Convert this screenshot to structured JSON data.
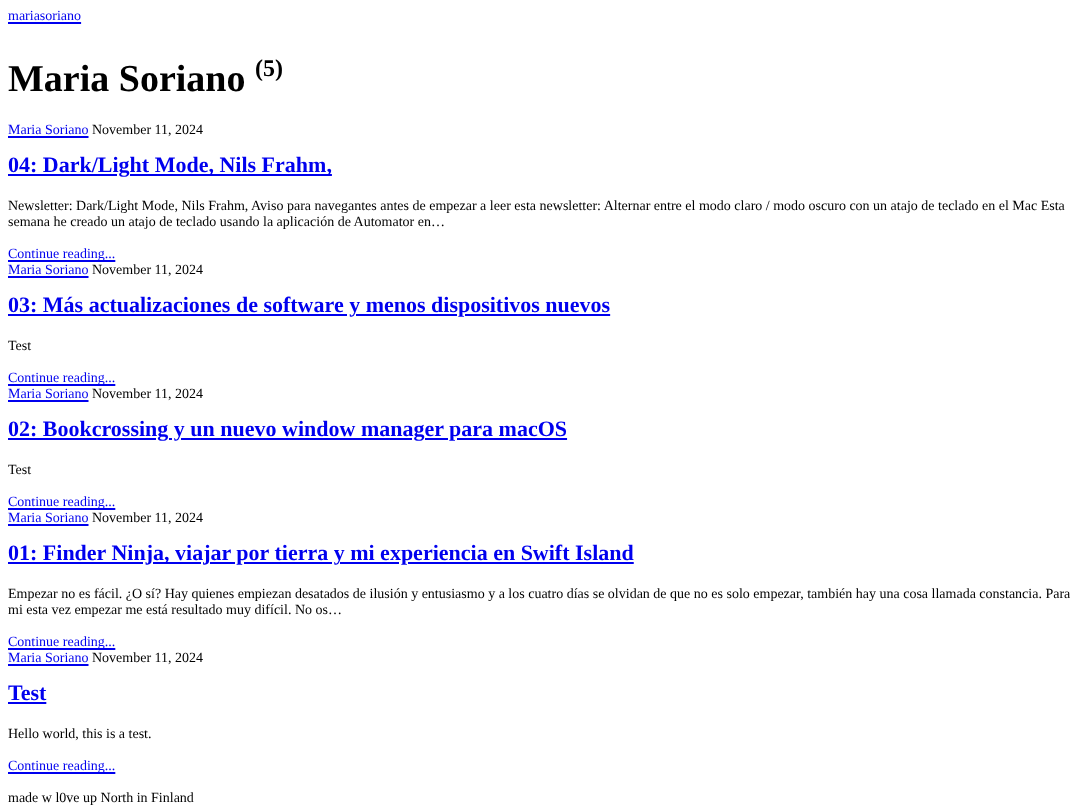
{
  "site_link": "mariasoriano",
  "heading": "Maria Soriano $^{(5)}$",
  "posts": [
    {
      "author": "Maria Soriano",
      "date": "November 11, 2024",
      "title": "04: Dark/Light Mode, Nils Frahm,",
      "excerpt": "Newsletter: Dark/Light Mode, Nils Frahm, Aviso para navegantes antes de empezar a leer esta newsletter: Alternar entre el modo claro / modo oscuro con un atajo de teclado en el Mac Esta semana he creado un atajo de teclado usando la aplicación de Automator en…",
      "more": "Continue reading..."
    },
    {
      "author": "Maria Soriano",
      "date": "November 11, 2024",
      "title": "03: Más actualizaciones de software y menos dispositivos nuevos",
      "excerpt": "Test",
      "more": "Continue reading..."
    },
    {
      "author": "Maria Soriano",
      "date": "November 11, 2024",
      "title": "02: Bookcrossing y un nuevo window manager para macOS",
      "excerpt": "Test",
      "more": "Continue reading..."
    },
    {
      "author": "Maria Soriano",
      "date": "November 11, 2024",
      "title": "01: Finder Ninja, viajar por tierra y mi experiencia en Swift Island",
      "excerpt": "Empezar no es fácil. ¿O sí? Hay quienes empiezan desatados de ilusión y entusiasmo y a los cuatro días se olvidan de que no es solo empezar, también hay una cosa llamada constancia. Para mi esta vez empezar me está resultado muy difícil. No os…",
      "more": "Continue reading..."
    },
    {
      "author": "Maria Soriano",
      "date": "November 11, 2024",
      "title": "Test",
      "excerpt": "Hello world, this is a test.",
      "more": "Continue reading..."
    }
  ],
  "footer": "made w l0ve up North in Finland"
}
